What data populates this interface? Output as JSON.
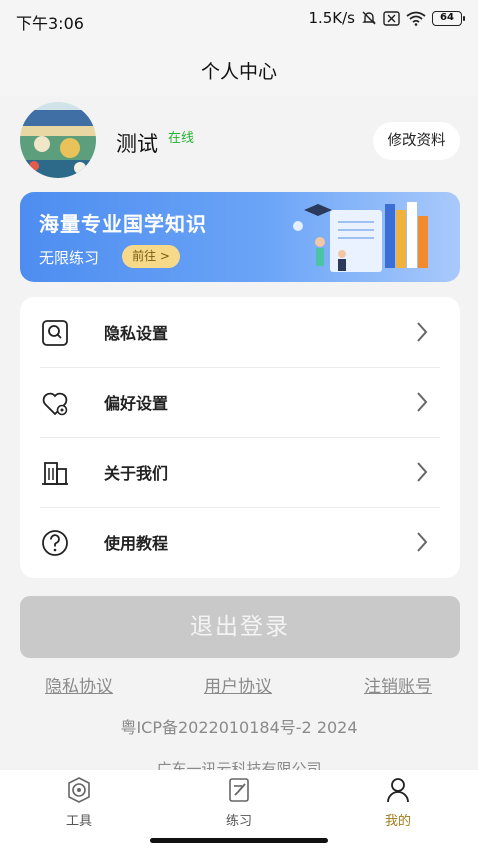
{
  "status_bar": {
    "time": "下午3:06",
    "network_speed": "1.5K/s",
    "battery": "64"
  },
  "header": {
    "title": "个人中心"
  },
  "profile": {
    "username": "测试",
    "status": "在线",
    "edit_label": "修改资料"
  },
  "banner": {
    "title": "海量专业国学知识",
    "subtitle": "无限练习",
    "go_label": "前往 >"
  },
  "menu": {
    "items": [
      {
        "label": "隐私设置",
        "icon": "privacy-search-icon"
      },
      {
        "label": "偏好设置",
        "icon": "heart-settings-icon"
      },
      {
        "label": "关于我们",
        "icon": "building-icon"
      },
      {
        "label": "使用教程",
        "icon": "help-circle-icon"
      }
    ]
  },
  "logout_label": "退出登录",
  "footer_links": {
    "privacy": "隐私协议",
    "user_agreement": "用户协议",
    "delete_account": "注销账号"
  },
  "icp": "粤ICP备2022010184号-2   2024",
  "company": "广东一讯云科技有限公司",
  "tabbar": {
    "items": [
      {
        "label": "工具",
        "icon": "tools-icon"
      },
      {
        "label": "练习",
        "icon": "practice-icon"
      },
      {
        "label": "我的",
        "icon": "profile-icon",
        "active": true
      }
    ]
  },
  "colors": {
    "accent": "#a07b1a",
    "online": "#27b335",
    "banner": "#5b96f3",
    "logout_bg": "#c9c9c9"
  }
}
